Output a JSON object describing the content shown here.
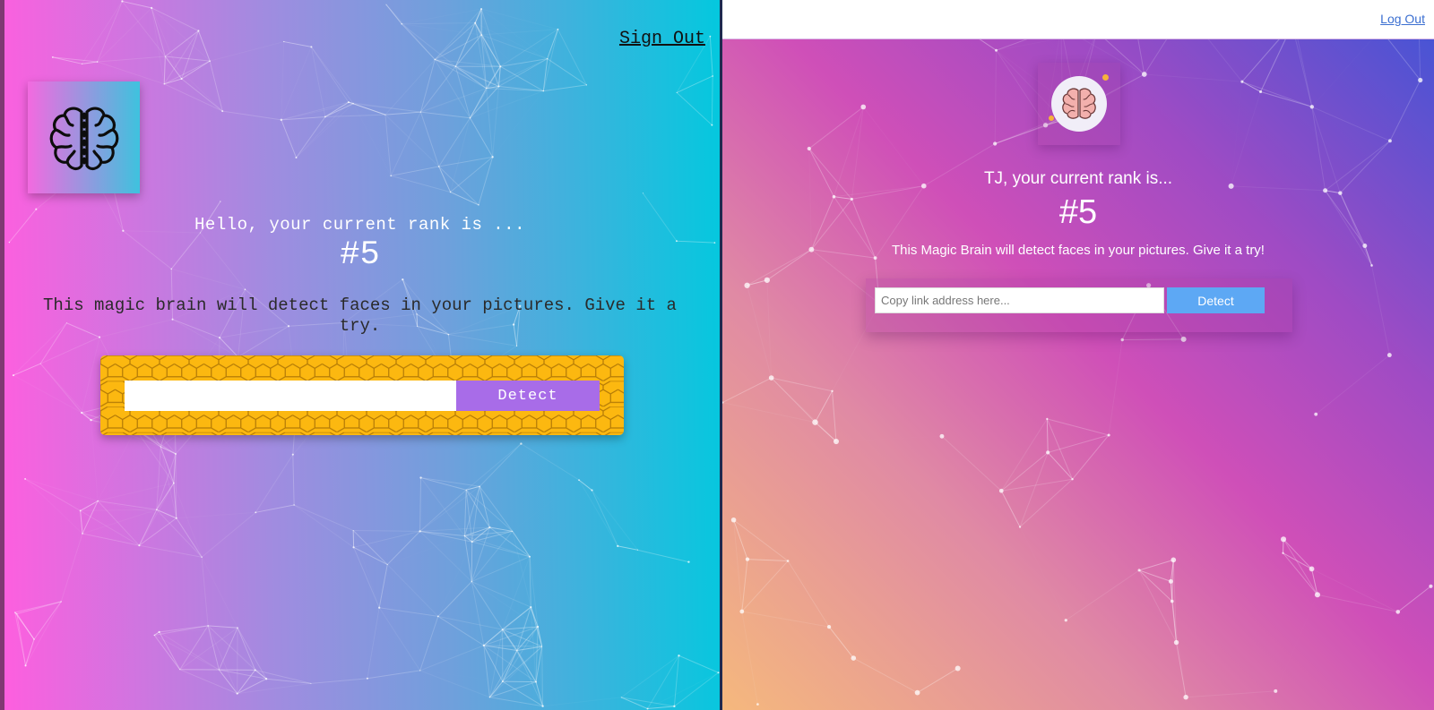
{
  "left_app": {
    "sign_out_label": "Sign Out",
    "logo_icon": "brain-icon",
    "rank_label": "Hello, your current rank is ...",
    "rank_value": "#5",
    "description": "This magic brain will detect faces in your pictures. Give it a try.",
    "url_input": {
      "value": "",
      "placeholder": ""
    },
    "detect_label": "Detect",
    "colors": {
      "gradient_start": "#ff5edf",
      "gradient_end": "#04c8de",
      "form_background": "#fcb810",
      "detect_button": "#a86ce8"
    }
  },
  "right_app": {
    "logout_label": "Log Out",
    "logo_icon": "brain-icon",
    "rank_label": "TJ, your current rank is...",
    "rank_value": "#5",
    "description": "This Magic Brain will detect faces in your pictures. Give it a try!",
    "url_input": {
      "value": "",
      "placeholder": "Copy link address here..."
    },
    "detect_label": "Detect",
    "colors": {
      "gradient_top_right": "#3f55d6",
      "gradient_bottom_left": "#f5b87d",
      "detect_button": "#5da8f4"
    }
  }
}
